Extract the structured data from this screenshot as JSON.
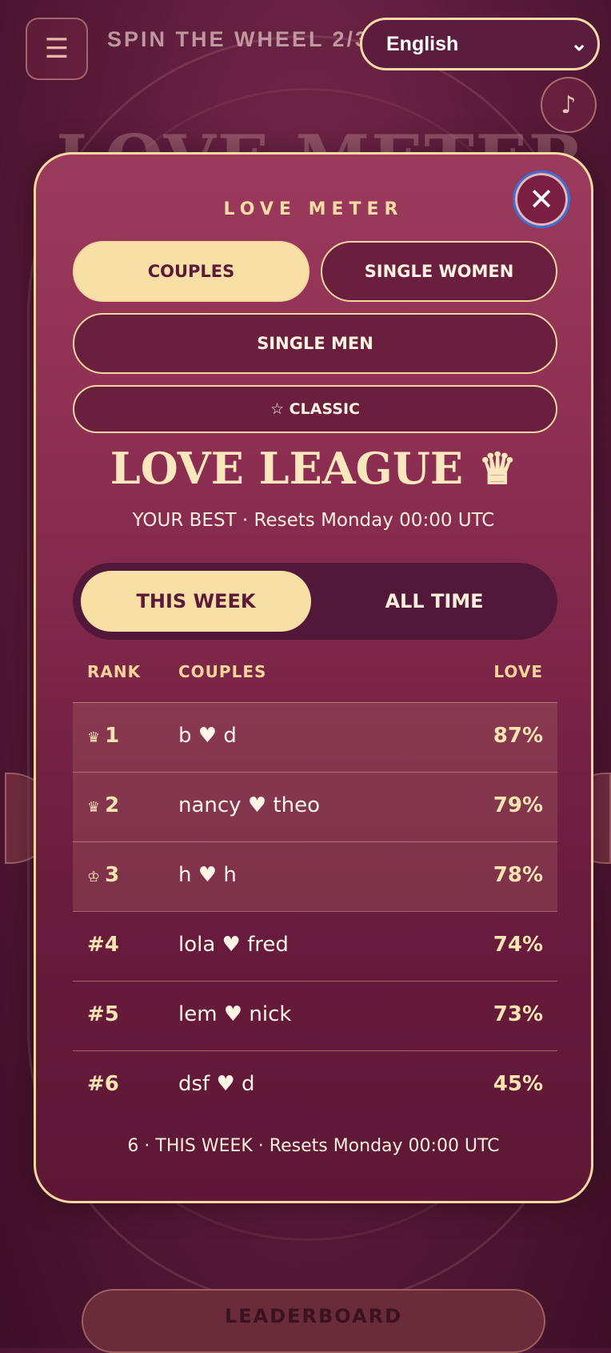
{
  "header": {
    "menu_icon": "hamburger-icon",
    "spin_label": "SPIN THE WHEEL 2/3",
    "language": "English",
    "music_icon": "music-note-icon"
  },
  "background": {
    "title": "LOVE METER",
    "leaderboard_button": "LEADERBOARD"
  },
  "modal": {
    "heading": "LOVE METER",
    "close_icon": "close-icon",
    "categories": [
      {
        "label": "COUPLES",
        "active": true
      },
      {
        "label": "SINGLE WOMEN",
        "active": false
      },
      {
        "label": "SINGLE MEN",
        "active": false
      },
      {
        "label": "☆ CLASSIC",
        "active": false
      }
    ],
    "league_title": "LOVE LEAGUE ♛",
    "subtitle": "YOUR BEST · Resets Monday 00:00 UTC",
    "period_tabs": [
      {
        "label": "THIS WEEK",
        "active": true
      },
      {
        "label": "ALL TIME",
        "active": false
      }
    ],
    "table": {
      "headers": {
        "rank": "RANK",
        "name": "COUPLES",
        "love": "LOVE"
      },
      "rows": [
        {
          "crown": "♛",
          "rank": "1",
          "name": "b ♥ d",
          "love": "87%"
        },
        {
          "crown": "♛",
          "rank": "2",
          "name": "nancy ♥ theo",
          "love": "79%"
        },
        {
          "crown": "♔",
          "rank": "3",
          "name": "h ♥ h",
          "love": "78%"
        },
        {
          "crown": "",
          "rank": "#4",
          "name": "lola ♥ fred",
          "love": "74%"
        },
        {
          "crown": "",
          "rank": "#5",
          "name": "lem ♥ nick",
          "love": "73%"
        },
        {
          "crown": "",
          "rank": "#6",
          "name": "dsf ♥ d",
          "love": "45%"
        }
      ]
    },
    "footer_note": "6 · THIS WEEK · Resets Monday 00:00 UTC"
  },
  "colors": {
    "accent": "#f8dfa5",
    "background": "#5e1c3b",
    "modal": "#8c2e52"
  }
}
